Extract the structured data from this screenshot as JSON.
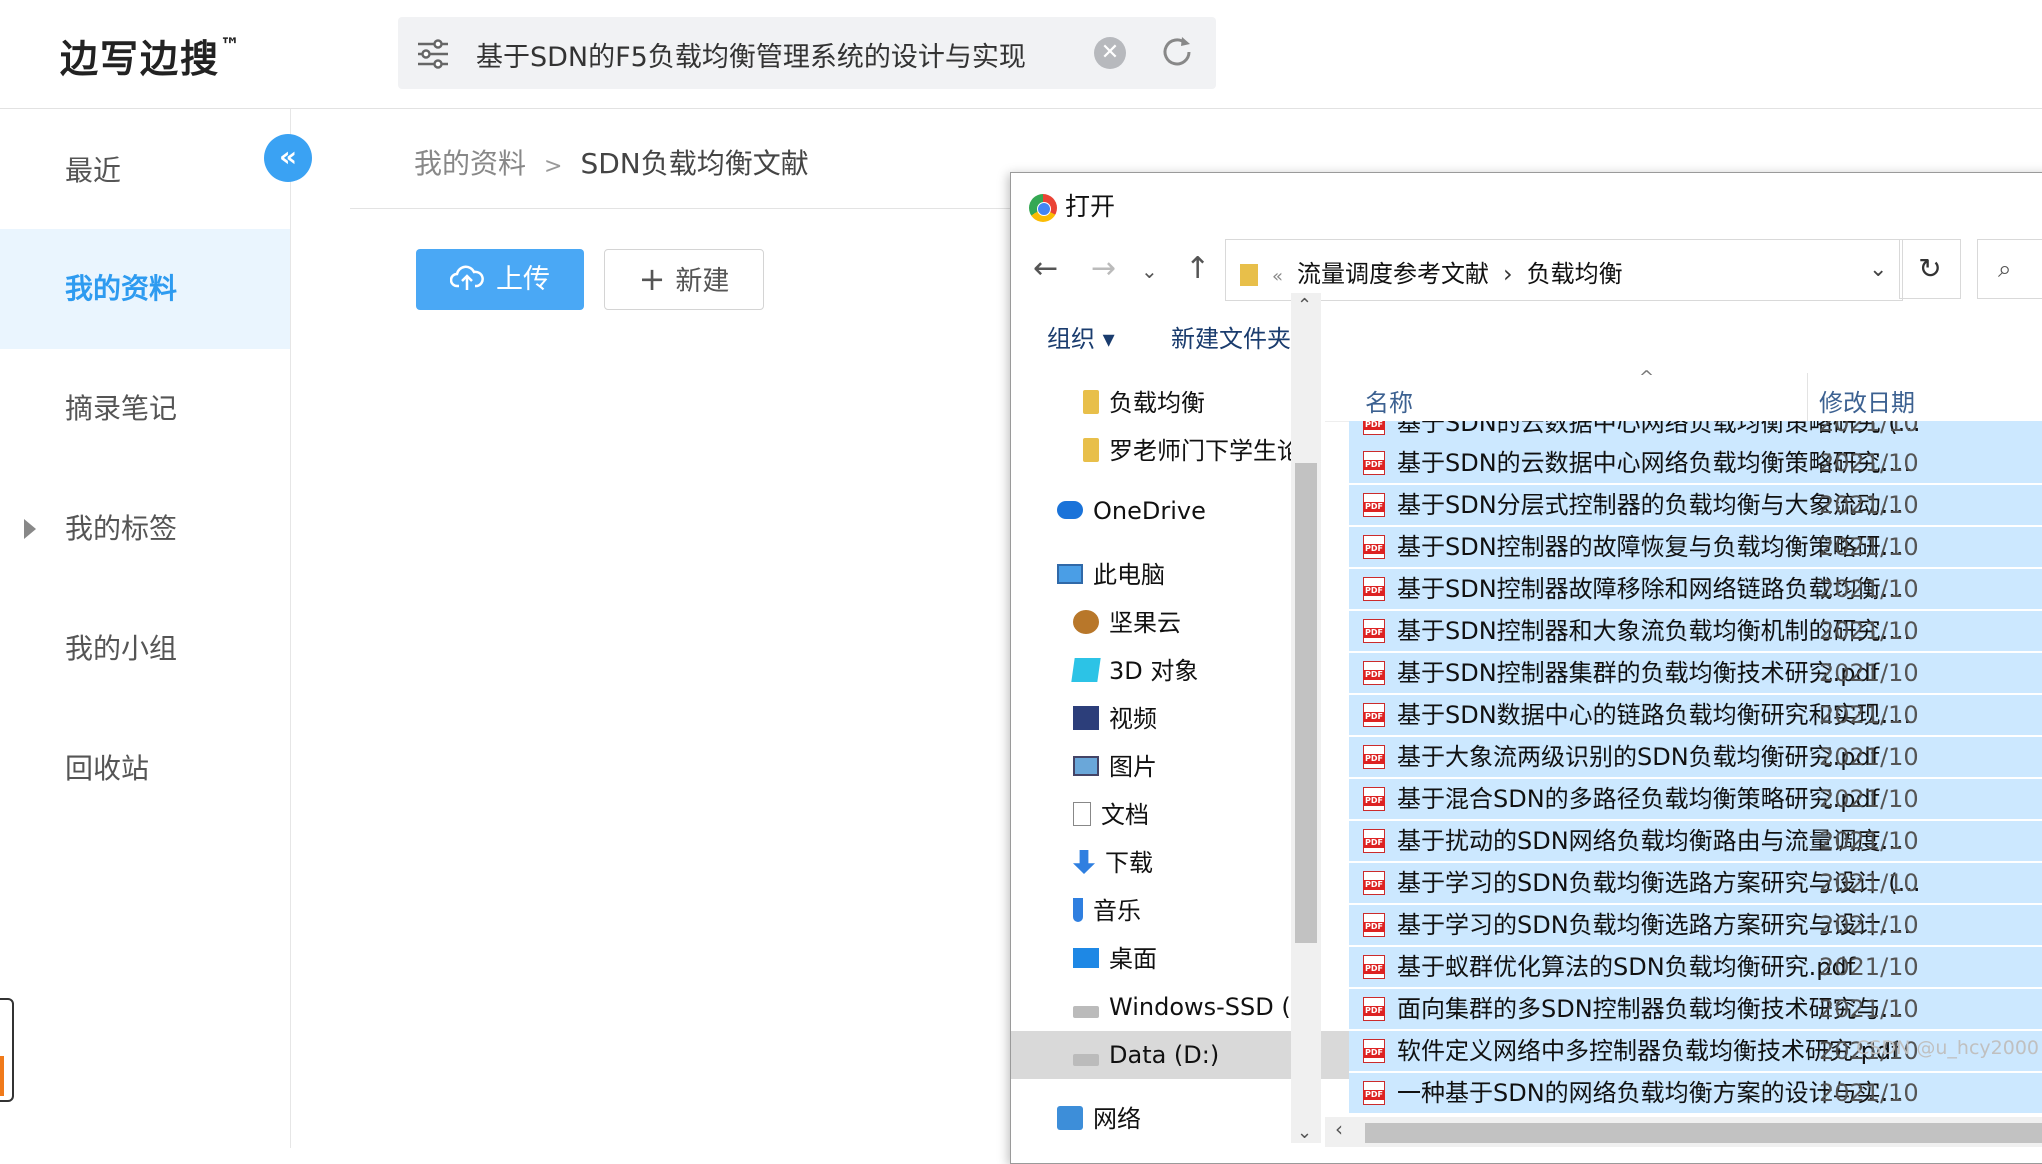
{
  "brand": {
    "name": "边写边搜",
    "tm": "™"
  },
  "search": {
    "query": "基于SDN的F5负载均衡管理系统的设计与实现"
  },
  "sidebar": {
    "items": [
      {
        "label": "最近"
      },
      {
        "label": "我的资料"
      },
      {
        "label": "摘录笔记"
      },
      {
        "label": "我的标签"
      },
      {
        "label": "我的小组"
      },
      {
        "label": "回收站"
      }
    ],
    "collapse_glyph": "«"
  },
  "breadcrumb": {
    "root": "我的资料",
    "sep": ">",
    "current": "SDN负载均衡文献"
  },
  "actions": {
    "upload": "上传",
    "new": "新建"
  },
  "dialog": {
    "title": "打开",
    "address": {
      "parent": "流量调度参考文献",
      "current": "负载均衡"
    },
    "toolbar": {
      "organize": "组织 ▾",
      "new_folder": "新建文件夹"
    },
    "nav": [
      {
        "label": "负载均衡",
        "icon": "folder-icon"
      },
      {
        "label": "罗老师门下学生论",
        "icon": "folder-icon"
      },
      {
        "label": "OneDrive",
        "icon": "onedrive-icon"
      },
      {
        "label": "此电脑",
        "icon": "this-pc-icon"
      },
      {
        "label": "坚果云",
        "icon": "nutstore-icon"
      },
      {
        "label": "3D 对象",
        "icon": "3d-objects-icon"
      },
      {
        "label": "视频",
        "icon": "video-icon"
      },
      {
        "label": "图片",
        "icon": "pictures-icon"
      },
      {
        "label": "文档",
        "icon": "documents-icon"
      },
      {
        "label": "下载",
        "icon": "downloads-icon"
      },
      {
        "label": "音乐",
        "icon": "music-icon"
      },
      {
        "label": "桌面",
        "icon": "desktop-icon"
      },
      {
        "label": "Windows-SSD (",
        "icon": "drive-icon"
      },
      {
        "label": "Data (D:)",
        "icon": "drive-icon"
      },
      {
        "label": "网络",
        "icon": "network-icon"
      }
    ],
    "columns": {
      "name": "名称",
      "date": "修改日期"
    },
    "files": [
      {
        "name": "基于SDN的云数据中心网络负载均衡策略研究 (...",
        "date": "2021/10"
      },
      {
        "name": "基于SDN的云数据中心网络负载均衡策略研究....",
        "date": "2021/10"
      },
      {
        "name": "基于SDN分层式控制器的负载均衡与大象流动...",
        "date": "2021/10"
      },
      {
        "name": "基于SDN控制器的故障恢复与负载均衡策略研...",
        "date": "2021/10"
      },
      {
        "name": "基于SDN控制器故障移除和网络链路负载均衡...",
        "date": "2021/10"
      },
      {
        "name": "基于SDN控制器和大象流负载均衡机制的研究....",
        "date": "2021/10"
      },
      {
        "name": "基于SDN控制器集群的负载均衡技术研究.pdf",
        "date": "2021/10"
      },
      {
        "name": "基于SDN数据中心的链路负载均衡研究和实现....",
        "date": "2021/10"
      },
      {
        "name": "基于大象流两级识别的SDN负载均衡研究.pdf",
        "date": "2021/10"
      },
      {
        "name": "基于混合SDN的多路径负载均衡策略研究.pdf",
        "date": "2021/10"
      },
      {
        "name": "基于扰动的SDN网络负载均衡路由与流量调度...",
        "date": "2021/10"
      },
      {
        "name": "基于学习的SDN负载均衡选路方案研究与设计 (...",
        "date": "2021/10"
      },
      {
        "name": "基于学习的SDN负载均衡选路方案研究与设计....",
        "date": "2021/10"
      },
      {
        "name": "基于蚁群优化算法的SDN负载均衡研究.pdf",
        "date": "2021/10"
      },
      {
        "name": "面向集群的多SDN控制器负载均衡技术研究与...",
        "date": "2021/10"
      },
      {
        "name": "软件定义网络中多控制器负载均衡技术研究.pdf",
        "date": "2021/10"
      },
      {
        "name": "一种基于SDN的网络负载均衡方案的设计与实...",
        "date": "2021/10"
      }
    ]
  },
  "watermark": "CSDN @u_hcy2000"
}
